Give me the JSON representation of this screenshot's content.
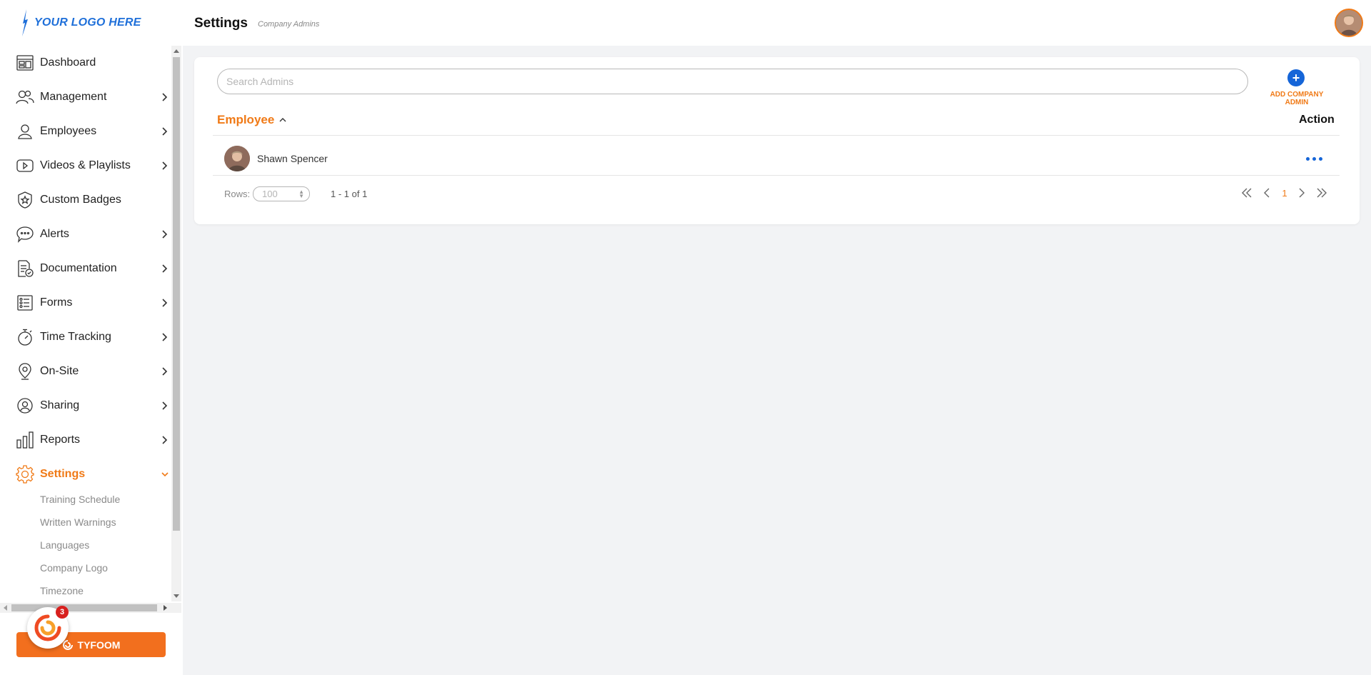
{
  "logo": {
    "text": "YOUR LOGO HERE"
  },
  "header": {
    "title": "Settings",
    "subtitle": "Company Admins"
  },
  "sidebar": {
    "items": [
      {
        "label": "Dashboard",
        "icon": "dashboard-icon",
        "has_chevron": false
      },
      {
        "label": "Management",
        "icon": "management-icon",
        "has_chevron": true
      },
      {
        "label": "Employees",
        "icon": "user-icon",
        "has_chevron": true
      },
      {
        "label": "Videos & Playlists",
        "icon": "video-icon",
        "has_chevron": true
      },
      {
        "label": "Custom Badges",
        "icon": "badge-icon",
        "has_chevron": false
      },
      {
        "label": "Alerts",
        "icon": "chat-icon",
        "has_chevron": true
      },
      {
        "label": "Documentation",
        "icon": "document-icon",
        "has_chevron": true
      },
      {
        "label": "Forms",
        "icon": "list-icon",
        "has_chevron": true
      },
      {
        "label": "Time Tracking",
        "icon": "stopwatch-icon",
        "has_chevron": true
      },
      {
        "label": "On-Site",
        "icon": "location-pin-icon",
        "has_chevron": true
      },
      {
        "label": "Sharing",
        "icon": "share-user-icon",
        "has_chevron": true
      },
      {
        "label": "Reports",
        "icon": "bar-chart-icon",
        "has_chevron": true
      },
      {
        "label": "Settings",
        "icon": "gear-icon",
        "has_chevron": true,
        "active": true
      }
    ],
    "sub_items": [
      "Training Schedule",
      "Written Warnings",
      "Languages",
      "Company Logo",
      "Timezone"
    ]
  },
  "tyfoom": {
    "label": "TYFOOM",
    "notification_count": "3"
  },
  "admins": {
    "search_placeholder": "Search Admins",
    "add_label": "ADD COMPANY ADMIN",
    "col_employee": "Employee",
    "col_action": "Action",
    "rows": [
      {
        "name": "Shawn Spencer"
      }
    ],
    "rows_label": "Rows:",
    "rows_value": "100",
    "range": "1 - 1 of 1",
    "current_page": "1"
  },
  "colors": {
    "accent": "#f07a17",
    "primary": "#1565d8",
    "tyfoom": "#f26f1e"
  }
}
